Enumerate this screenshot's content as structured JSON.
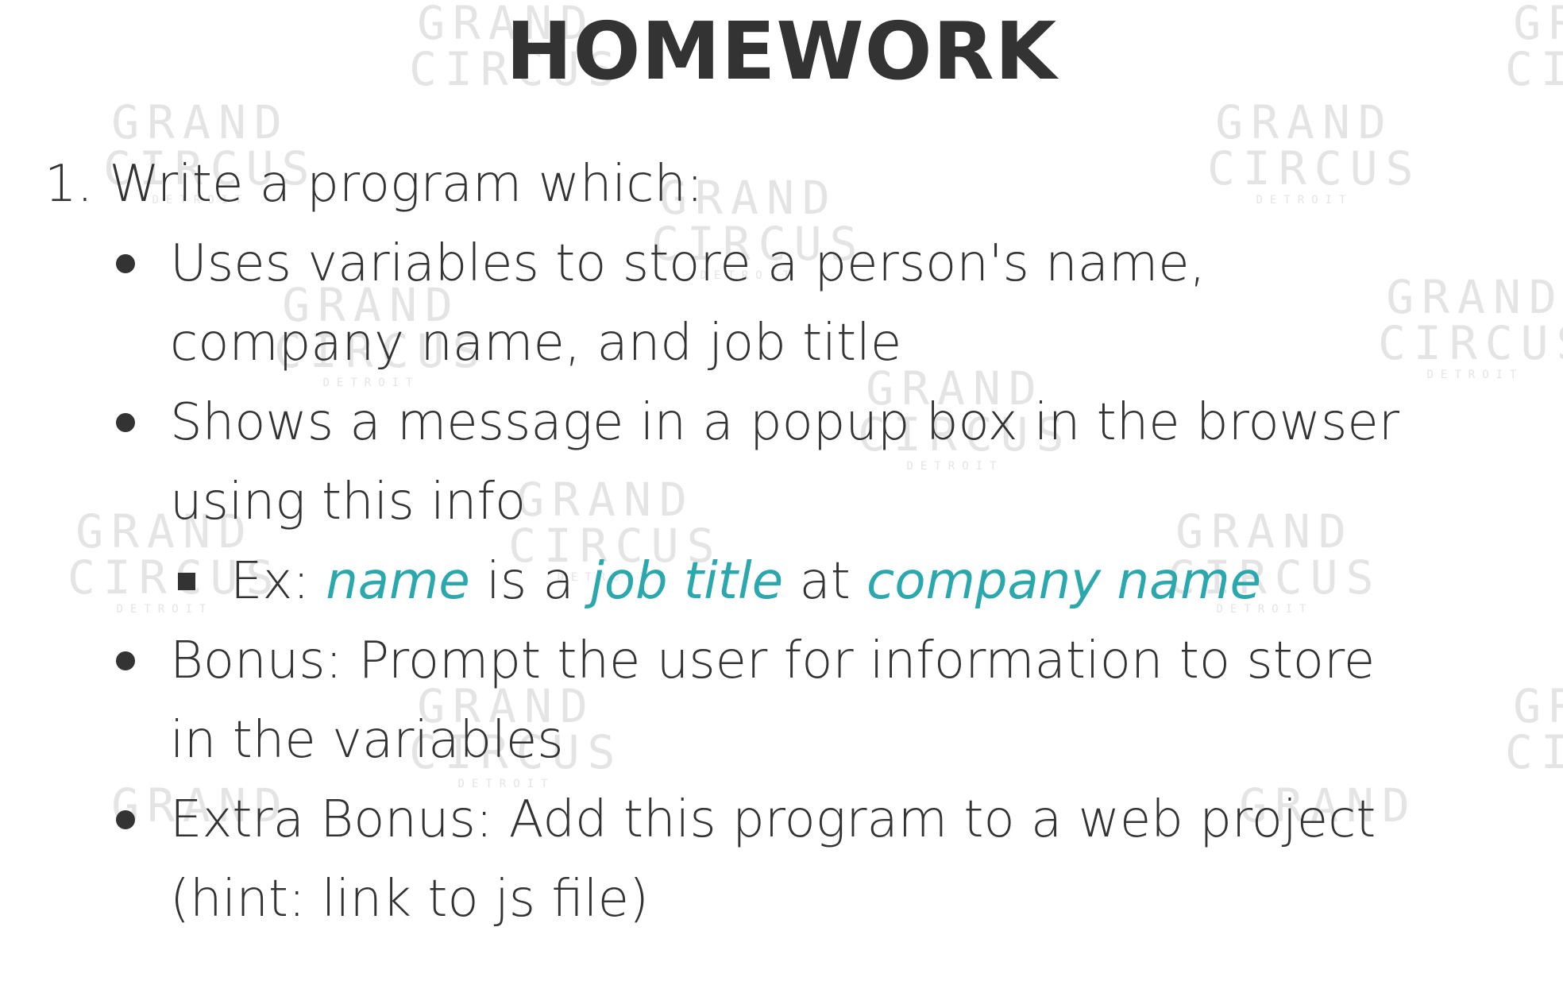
{
  "slide": {
    "title": "HOMEWORK",
    "watermark": {
      "line1": "GRAND",
      "line2": "CIRCUS",
      "line3": "DETROIT"
    },
    "item_number": "1.",
    "item_text": "Write a program which:",
    "bullets": [
      {
        "lines": [
          "Uses variables to store a person's name,",
          "company name, and job title"
        ]
      },
      {
        "lines": [
          "Shows a message in a popup box in the browser",
          "using this info"
        ]
      },
      {
        "lines": [
          "Bonus: Prompt the user for information to store",
          "in the variables"
        ]
      },
      {
        "lines": [
          "Extra Bonus: Add this program to a web project",
          "(hint: link to js file)"
        ]
      }
    ],
    "example": {
      "prefix": "Ex:",
      "name": "name",
      "is_a": "is a",
      "job_title": "job title",
      "at": "at",
      "company_name": "company name"
    },
    "colors": {
      "text": "#333333",
      "highlight": "#2aa8ad",
      "watermark": "#e4e4e4",
      "background": "#ffffff"
    }
  }
}
